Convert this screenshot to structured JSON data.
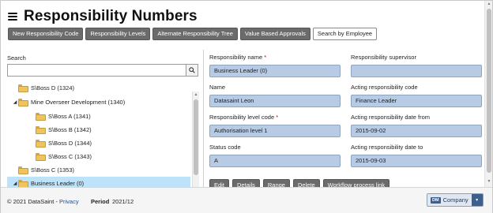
{
  "page": {
    "title": "Responsibility Numbers"
  },
  "toolbar": {
    "buttons": [
      "New Responsibility Code",
      "Responsibility Levels",
      "Alternate Responsibility Tree",
      "Value Based Approvals",
      "Search by Employee"
    ]
  },
  "search": {
    "label": "Search",
    "value": "",
    "placeholder": ""
  },
  "tree": {
    "items": [
      {
        "label": "S\\Boss D (1324)",
        "expanded": false,
        "selected": false
      },
      {
        "label": "Mine Overseer Development (1340)",
        "expanded": true,
        "selected": false
      },
      {
        "label": "S\\Boss A (1341)",
        "expanded": false,
        "selected": false
      },
      {
        "label": "S\\Boss B (1342)",
        "expanded": false,
        "selected": false
      },
      {
        "label": "S\\Boss D (1344)",
        "expanded": false,
        "selected": false
      },
      {
        "label": "S\\Boss C (1343)",
        "expanded": false,
        "selected": false
      },
      {
        "label": "S\\Boss C (1353)",
        "expanded": false,
        "selected": false
      },
      {
        "label": "Business Leader (0)",
        "expanded": true,
        "selected": true
      }
    ]
  },
  "form": {
    "required_marker": "*",
    "responsibility_name": {
      "label": "Responsibility name",
      "value": "Business Leader (0)"
    },
    "responsibility_supervisor": {
      "label": "Responsibility supervisor",
      "value": ""
    },
    "name": {
      "label": "Name",
      "value": "Datasaint Leon"
    },
    "acting_responsibility_code": {
      "label": "Acting responsibility code",
      "value": "Finance Leader"
    },
    "responsibility_level_code": {
      "label": "Responsibility level code",
      "value": "Authorisation level 1"
    },
    "acting_responsibility_date_from": {
      "label": "Acting responsibility date from",
      "value": "2015-09-02"
    },
    "status_code": {
      "label": "Status code",
      "value": "A"
    },
    "acting_responsibility_date_to": {
      "label": "Acting responsibility date to",
      "value": "2015-09-03"
    }
  },
  "actions": {
    "edit": "Edit",
    "details": "Details",
    "range": "Range",
    "delete": "Delete",
    "workflow": "Workflow process link"
  },
  "footer": {
    "copyright": "© 2021 DataSaint - ",
    "privacy": "Privacy",
    "period_label": "Period",
    "period_value": "2021/12",
    "company_badge": "DM",
    "company_label": "Company"
  },
  "colors": {
    "toolbar_button": "#6b6b6b",
    "field_background": "#b8cbe4",
    "selected_row": "#bde3fb",
    "required": "#cc0000"
  },
  "icons": [
    "hamburger-menu-icon",
    "search-icon",
    "folder-icon",
    "caret-down-icon",
    "collapse-caret-icon"
  ]
}
